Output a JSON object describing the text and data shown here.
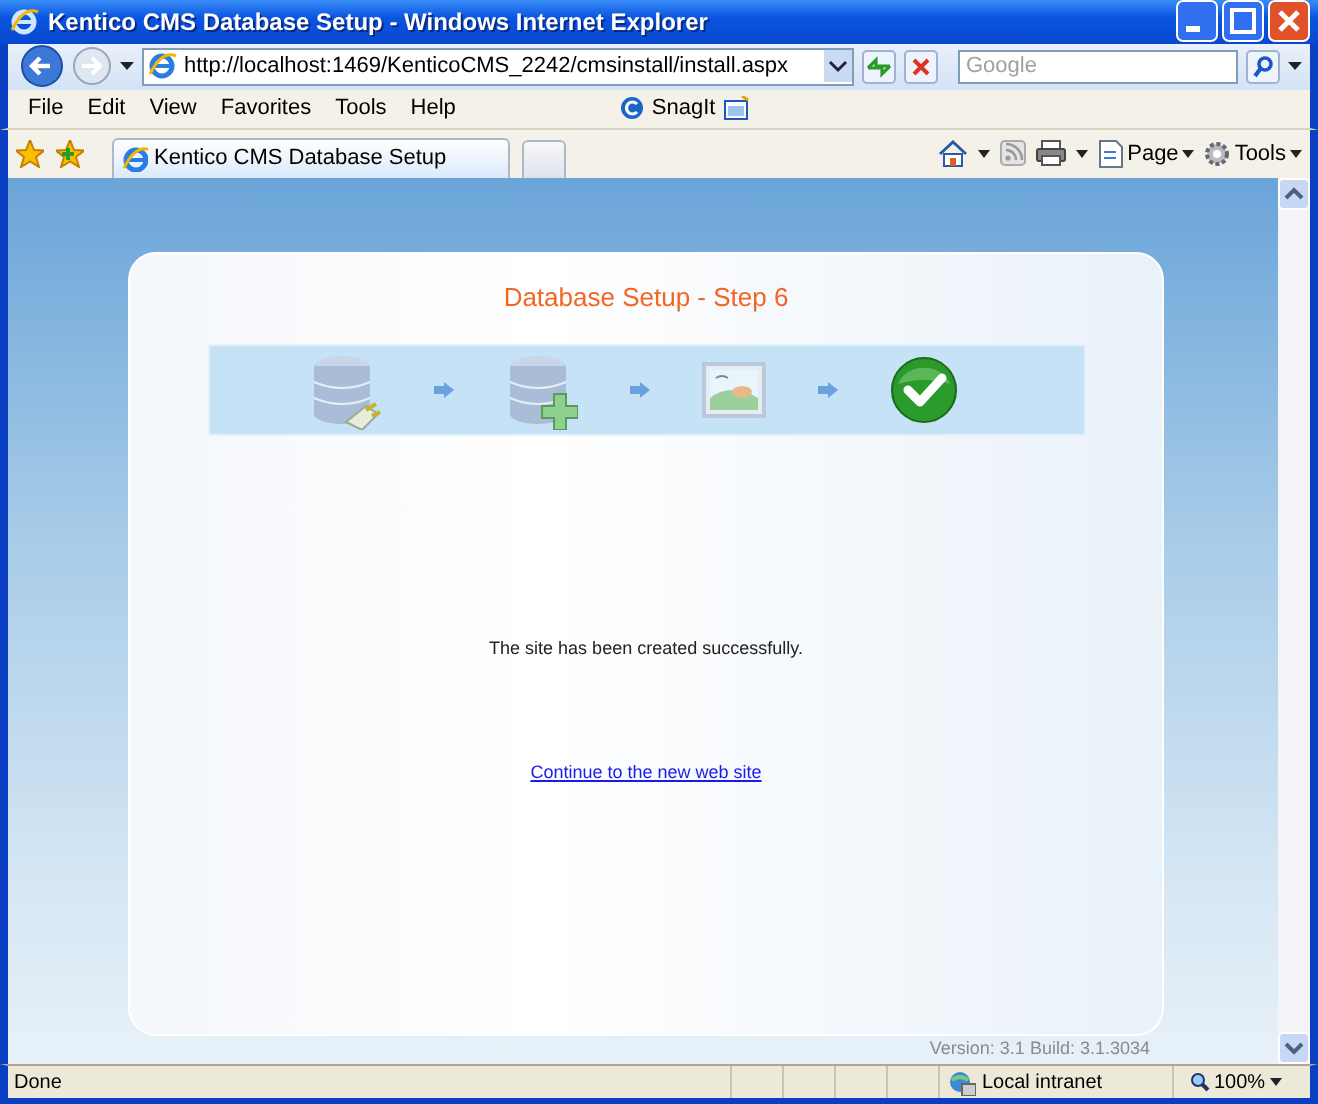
{
  "window": {
    "title": "Kentico CMS Database Setup - Windows Internet Explorer"
  },
  "address_bar": {
    "value": "http://localhost:1469/KenticoCMS_2242/cmsinstall/install.aspx"
  },
  "search": {
    "placeholder": "Google"
  },
  "menu": [
    "File",
    "Edit",
    "View",
    "Favorites",
    "Tools",
    "Help"
  ],
  "snagit": {
    "label": "SnagIt"
  },
  "tabs": [
    {
      "label": "Kentico CMS Database Setup",
      "selected": true
    }
  ],
  "command_bar": [
    {
      "label": "Page"
    },
    {
      "label": "Tools"
    }
  ],
  "page": {
    "title": "Database Setup - Step 6",
    "steps": [
      {
        "kind": "database"
      },
      {
        "kind": "add-database"
      },
      {
        "kind": "image"
      },
      {
        "kind": "done"
      }
    ],
    "message": "The site has been created successfully.",
    "link": "Continue to the new web site",
    "version": "Version: 3.1 Build: 3.1.3034"
  },
  "status_bar": {
    "text": "Done",
    "zone": "Local intranet",
    "zoom": "100%"
  }
}
